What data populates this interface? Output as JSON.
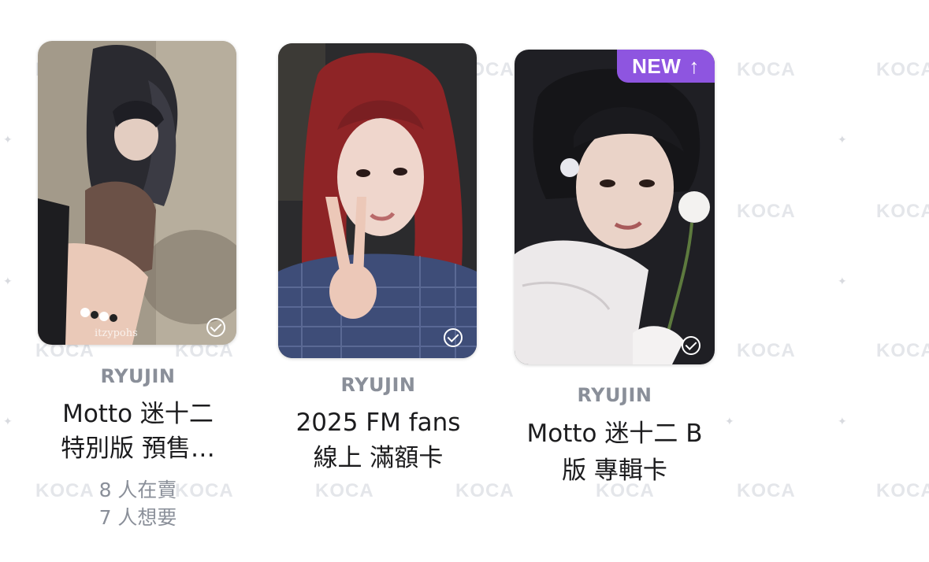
{
  "watermark": "KOCA",
  "cards": [
    {
      "artist": "RYUJIN",
      "title_line1": "Motto 迷十二",
      "title_line2": "特別版 預售…",
      "sellers": "8 人在賣",
      "wanters": "7 人想要",
      "photo_caption": "itzypohs"
    },
    {
      "artist": "RYUJIN",
      "title_line1": "2025 FM fans",
      "title_line2": "線上 滿額卡"
    },
    {
      "artist": "RYUJIN",
      "title_line1": "Motto 迷十二 B",
      "title_line2": "版 專輯卡",
      "badge": "NEW",
      "badge_icon": "arrow-up-icon"
    }
  ],
  "colors": {
    "badge": "#8e55e0",
    "artist": "#8a8f99",
    "title": "#1c1c1e"
  }
}
